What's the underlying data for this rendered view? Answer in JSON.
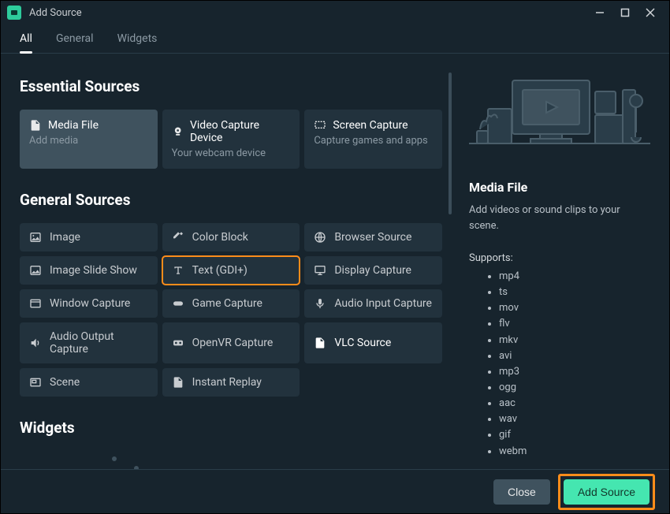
{
  "window": {
    "title": "Add Source"
  },
  "tabs": {
    "all": "All",
    "general": "General",
    "widgets": "Widgets"
  },
  "sections": {
    "essential": "Essential Sources",
    "general": "General Sources",
    "widgets": "Widgets"
  },
  "essential": [
    {
      "title": "Media File",
      "sub": "Add media"
    },
    {
      "title": "Video Capture Device",
      "sub": "Your webcam device"
    },
    {
      "title": "Screen Capture",
      "sub": "Capture games and apps"
    }
  ],
  "general": [
    {
      "label": "Image"
    },
    {
      "label": "Color Block"
    },
    {
      "label": "Browser Source"
    },
    {
      "label": "Image Slide Show"
    },
    {
      "label": "Text (GDI+)"
    },
    {
      "label": "Display Capture"
    },
    {
      "label": "Window Capture"
    },
    {
      "label": "Game Capture"
    },
    {
      "label": "Audio Input Capture"
    },
    {
      "label": "Audio Output Capture"
    },
    {
      "label": "OpenVR Capture"
    },
    {
      "label": "VLC Source"
    },
    {
      "label": "Scene"
    },
    {
      "label": "Instant Replay"
    }
  ],
  "detail": {
    "title": "Media File",
    "desc": "Add videos or sound clips to your scene.",
    "supports_label": "Supports:",
    "formats": [
      "mp4",
      "ts",
      "mov",
      "flv",
      "mkv",
      "avi",
      "mp3",
      "ogg",
      "aac",
      "wav",
      "gif",
      "webm"
    ]
  },
  "footer": {
    "close": "Close",
    "add": "Add Source"
  }
}
